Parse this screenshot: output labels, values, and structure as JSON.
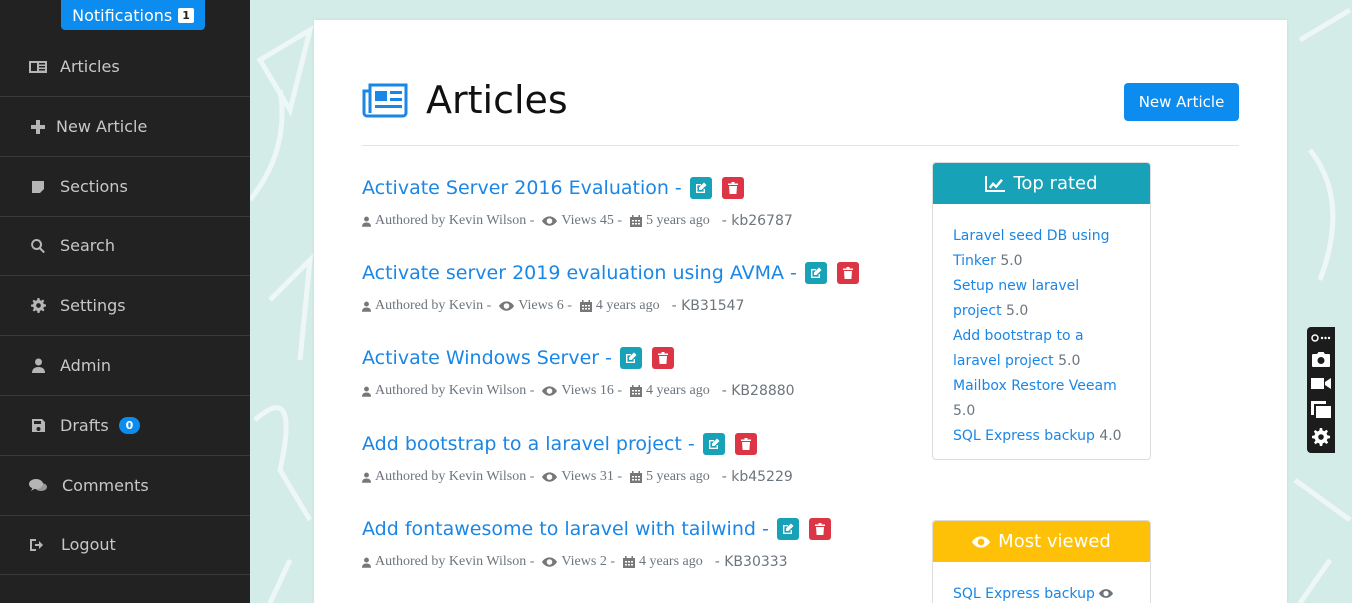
{
  "notifications": {
    "label": "Notifications",
    "count": "1"
  },
  "sidebar": {
    "items": [
      {
        "label": "Articles",
        "icon": "newspaper-icon"
      },
      {
        "label": "New Article",
        "icon": "plus-icon"
      },
      {
        "label": "Sections",
        "icon": "sticky-note-icon"
      },
      {
        "label": "Search",
        "icon": "search-icon"
      },
      {
        "label": "Settings",
        "icon": "gear-icon"
      },
      {
        "label": "Admin",
        "icon": "user-icon"
      },
      {
        "label": "Drafts",
        "icon": "save-icon",
        "badge": "0"
      },
      {
        "label": "Comments",
        "icon": "comments-icon"
      },
      {
        "label": "Logout",
        "icon": "sign-out-icon"
      }
    ]
  },
  "page": {
    "title": "Articles",
    "new_button": "New Article"
  },
  "articles": [
    {
      "title": "Activate Server 2016 Evaluation -",
      "author": "Authored by Kevin Wilson -",
      "views": "Views 45 -",
      "age": "5 years ago",
      "kb": "- kb26787"
    },
    {
      "title": "Activate server 2019 evaluation using AVMA -",
      "author": "Authored by Kevin -",
      "views": "Views 6 -",
      "age": "4 years ago",
      "kb": "- KB31547"
    },
    {
      "title": "Activate Windows Server -",
      "author": "Authored by Kevin Wilson -",
      "views": "Views 16 -",
      "age": "4 years ago",
      "kb": "- KB28880"
    },
    {
      "title": "Add bootstrap to a laravel project -",
      "author": "Authored by Kevin Wilson -",
      "views": "Views 31 -",
      "age": "5 years ago",
      "kb": "- kb45229"
    },
    {
      "title": "Add fontawesome to laravel with tailwind -",
      "author": "Authored by Kevin Wilson -",
      "views": "Views 2 -",
      "age": "4 years ago",
      "kb": "- KB30333"
    }
  ],
  "top_rated": {
    "title": "Top rated",
    "items": [
      {
        "label": "Laravel seed DB using Tinker",
        "score": "5.0"
      },
      {
        "label": "Setup new laravel project",
        "score": "5.0"
      },
      {
        "label": "Add bootstrap to a laravel project",
        "score": "5.0"
      },
      {
        "label": "Mailbox Restore Veeam",
        "score": "5.0"
      },
      {
        "label": "SQL Express backup",
        "score": "4.0"
      }
    ]
  },
  "most_viewed": {
    "title": "Most viewed",
    "items": [
      {
        "label": "SQL Express backup"
      }
    ]
  },
  "colors": {
    "primary": "#0d8cf0",
    "info": "#17a2b8",
    "danger": "#dc3545",
    "warning": "#ffc107",
    "sidebar": "#222222"
  }
}
